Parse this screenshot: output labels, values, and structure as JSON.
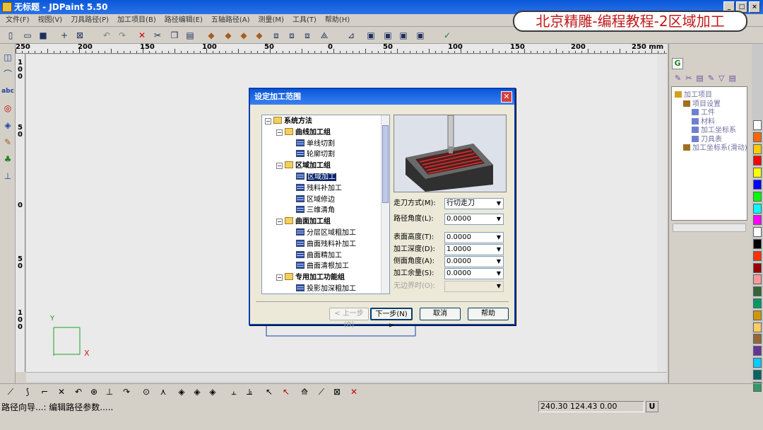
{
  "window": {
    "title": "无标题 - JDPaint 5.50"
  },
  "brand_banner": "北京精雕-编程教程-2区域加工",
  "menu": [
    "文件(F)",
    "视图(V)",
    "刀具路径(P)",
    "加工项目(B)",
    "路径编辑(E)",
    "五轴路径(A)",
    "测量(M)",
    "工具(T)",
    "帮助(H)"
  ],
  "ruler": {
    "unit": "mm",
    "h_labels": [
      "250",
      "200",
      "150",
      "100",
      "50",
      "0",
      "50",
      "100",
      "150",
      "200",
      "250 mm"
    ],
    "v_labels": [
      "1\n0\n0",
      "5\n0",
      "0",
      "5\n0",
      "1\n0\n0"
    ]
  },
  "canvas": {
    "axis_x": "X",
    "axis_y": "Y"
  },
  "dialog": {
    "title": "设定加工范围",
    "tree": [
      {
        "label": "系统方法",
        "kind": "folder",
        "level": 0
      },
      {
        "label": "曲线加工组",
        "kind": "folder",
        "level": 1
      },
      {
        "label": "单线切割",
        "kind": "item",
        "level": 2
      },
      {
        "label": "轮廓切割",
        "kind": "item",
        "level": 2
      },
      {
        "label": "区域加工组",
        "kind": "folder",
        "level": 1
      },
      {
        "label": "区域加工",
        "kind": "item",
        "level": 2,
        "selected": true
      },
      {
        "label": "残料补加工",
        "kind": "item",
        "level": 2
      },
      {
        "label": "区域修边",
        "kind": "item",
        "level": 2
      },
      {
        "label": "三维清角",
        "kind": "item",
        "level": 2
      },
      {
        "label": "曲面加工组",
        "kind": "folder",
        "level": 1
      },
      {
        "label": "分层区域粗加工",
        "kind": "item",
        "level": 2
      },
      {
        "label": "曲面残料补加工",
        "kind": "item",
        "level": 2
      },
      {
        "label": "曲面精加工",
        "kind": "item",
        "level": 2
      },
      {
        "label": "曲面清根加工",
        "kind": "item",
        "level": 2
      },
      {
        "label": "专用加工功能组",
        "kind": "folder",
        "level": 1
      },
      {
        "label": "投影加深粗加工",
        "kind": "item",
        "level": 2
      }
    ],
    "fields": [
      {
        "label": "走刀方式(M):",
        "value": "行切走刀",
        "enabled": true
      },
      {
        "label": "路径角度(L):",
        "value": "0.0000",
        "enabled": true
      },
      {
        "label": "表面高度(T):",
        "value": "0.0000",
        "enabled": true
      },
      {
        "label": "加工深度(D):",
        "value": "1.0000",
        "enabled": true
      },
      {
        "label": "侧面角度(A):",
        "value": "0.0000",
        "enabled": true
      },
      {
        "label": "加工余量(S):",
        "value": "0.0000",
        "enabled": true
      },
      {
        "label": "无边界时(O):",
        "value": "",
        "enabled": false
      }
    ],
    "buttons": {
      "prev": "< 上一步(B)",
      "next": "下一步(N) >",
      "cancel": "取消",
      "help": "帮助"
    }
  },
  "right_panel": {
    "tab": "G",
    "tree": [
      {
        "label": "加工项目",
        "level": 0
      },
      {
        "label": "项目设置",
        "level": 1
      },
      {
        "label": "工件",
        "level": 2
      },
      {
        "label": "材料",
        "level": 2
      },
      {
        "label": "加工坐标系",
        "level": 2
      },
      {
        "label": "刀具表",
        "level": 2
      },
      {
        "label": "加工坐标系(滑动)",
        "level": 1
      }
    ]
  },
  "palette": [
    "#ffffff",
    "#ff6600",
    "#ffcc00",
    "#ff0000",
    "#ffff00",
    "#0000ff",
    "#00ff00",
    "#00ffff",
    "#ff00ff",
    "#ffffff",
    "#000000",
    "#ff3300",
    "#990000",
    "#ff9999",
    "#336633",
    "#009966",
    "#cc9900",
    "#ffcc66",
    "#996633",
    "#663399",
    "#00ccff",
    "#006666",
    "#339966"
  ],
  "status": {
    "text": "路径向导...: 编辑路径参数.....",
    "coords": "240.30 124.43 0.00",
    "unit": "U"
  }
}
